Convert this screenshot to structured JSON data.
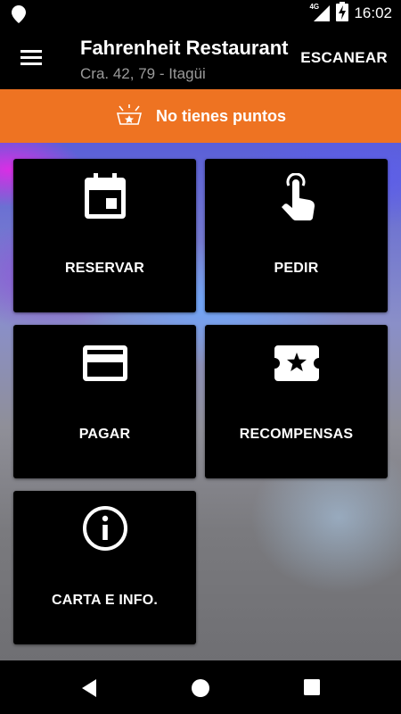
{
  "status_bar": {
    "network": "4G",
    "time": "16:02",
    "icons": [
      "location-pin-icon",
      "signal-icon",
      "battery-charging-icon"
    ]
  },
  "app_bar": {
    "title": "Fahrenheit Restaurant",
    "subtitle": "Cra. 42, 79 - Itagüi",
    "menu_icon": "hamburger-menu-icon",
    "scan_label": "ESCANEAR"
  },
  "points_banner": {
    "icon": "award-badge-icon",
    "text": "No tienes puntos",
    "color": "#ee7322"
  },
  "tiles": [
    {
      "label": "RESERVAR",
      "icon": "calendar-icon"
    },
    {
      "label": "PEDIR",
      "icon": "touch-hand-icon"
    },
    {
      "label": "PAGAR",
      "icon": "credit-card-icon"
    },
    {
      "label": "RECOMPENSAS",
      "icon": "ticket-star-icon"
    },
    {
      "label": "CARTA E INFO.",
      "icon": "info-icon"
    }
  ],
  "nav_bar": {
    "buttons": [
      "back-triangle-icon",
      "home-circle-icon",
      "recents-square-icon"
    ]
  }
}
